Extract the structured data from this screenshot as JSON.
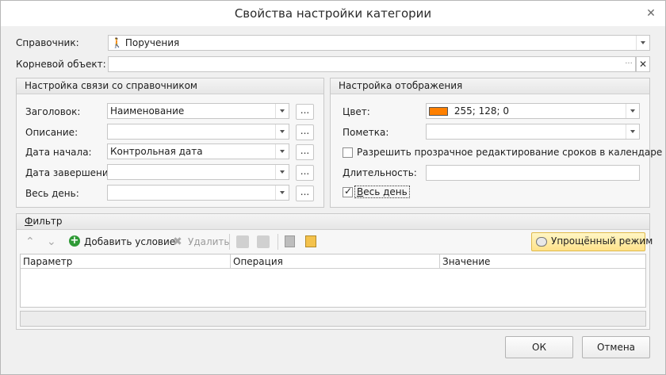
{
  "window": {
    "title": "Свойства настройки категории"
  },
  "directory": {
    "label": "Справочник:",
    "value": "Поручения",
    "icon": "person-walking-icon"
  },
  "root_object": {
    "label": "Корневой объект:",
    "value": "",
    "browse_label": "···",
    "clear_label": "✕"
  },
  "link_group": {
    "title": "Настройка связи со справочником",
    "rows": [
      {
        "label": "Заголовок:",
        "value": "Наименование"
      },
      {
        "label": "Описание:",
        "value": ""
      },
      {
        "label": "Дата начала:",
        "value": "Контрольная дата"
      },
      {
        "label": "Дата завершения:",
        "value": ""
      },
      {
        "label": "Весь день:",
        "value": ""
      }
    ],
    "dots_label": "..."
  },
  "display_group": {
    "title": "Настройка отображения",
    "color_label": "Цвет:",
    "color_value": "255; 128; 0",
    "color_swatch": "#ff8000",
    "mark_label": "Пометка:",
    "mark_value": "",
    "transparent_edit_label": "Разрешить прозрачное редактирование сроков в календаре",
    "transparent_edit_checked": false,
    "duration_label": "Длительность:",
    "duration_value": "",
    "all_day_first": "В",
    "all_day_rest": "есь день",
    "all_day_checked": true
  },
  "filter": {
    "title_first": "Ф",
    "title_rest": "ильтр",
    "toolbar": {
      "add_label": "Добавить условие",
      "delete_label": "Удалить",
      "simple_mode_label": "Упрощённый режим"
    },
    "columns": [
      "Параметр",
      "Операция",
      "Значение"
    ]
  },
  "buttons": {
    "ok": "ОК",
    "cancel": "Отмена"
  }
}
